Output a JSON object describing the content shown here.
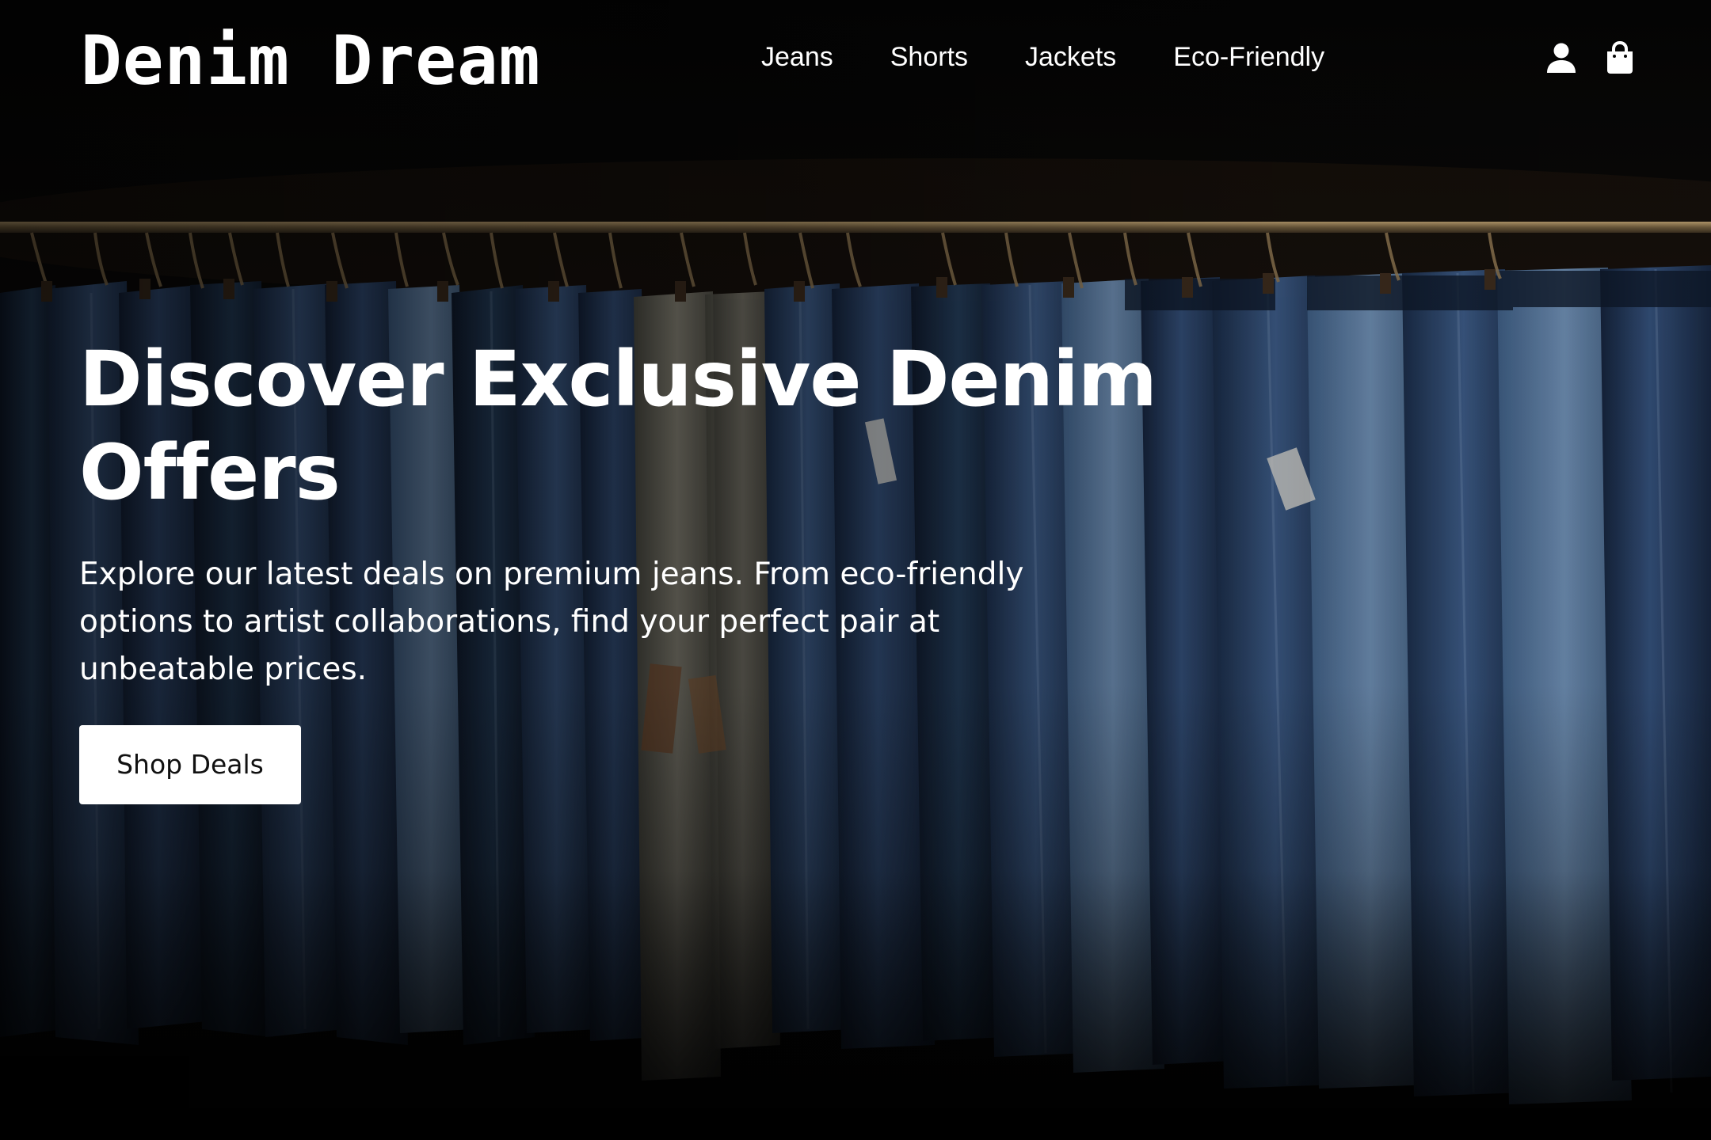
{
  "brand": {
    "name": "Denim Dream"
  },
  "nav": {
    "items": [
      {
        "label": "Jeans"
      },
      {
        "label": "Shorts"
      },
      {
        "label": "Jackets"
      },
      {
        "label": "Eco-Friendly"
      }
    ]
  },
  "header_icons": {
    "account": "user-icon",
    "cart": "shopping-bag-icon"
  },
  "hero": {
    "title": "Discover Exclusive Denim Offers",
    "subtitle": "Explore our latest deals on premium jeans. From eco-friendly options to artist collaborations, find your perfect pair at unbeatable prices.",
    "cta_label": "Shop Deals",
    "background_image": "rack of hanging denim jeans on a brass rail against a dark backdrop"
  },
  "colors": {
    "background": "#050505",
    "text": "#ffffff",
    "cta_background": "#ffffff",
    "cta_text": "#111111",
    "denim_dark": "#1b2c44",
    "denim_mid": "#2f4a6e",
    "rail": "#8a7450"
  }
}
